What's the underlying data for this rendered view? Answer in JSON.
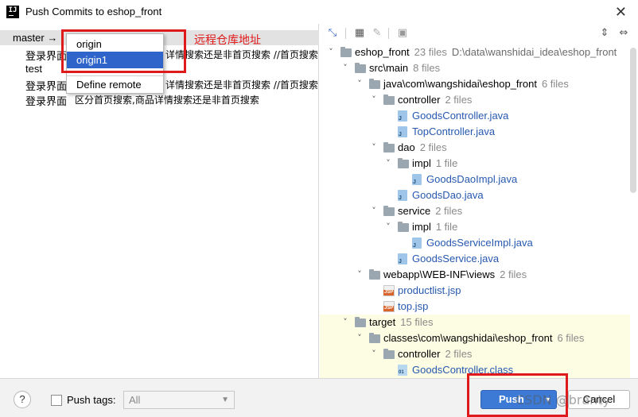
{
  "window": {
    "title": "Push Commits to eshop_front",
    "app_icon_text": "IJ"
  },
  "left": {
    "branch_label": "master →",
    "commits": [
      {
        "text": "登录界面",
        "desc": "详情搜索还是非首页搜索  //首页搜索"
      },
      {
        "text": "test",
        "desc": ""
      },
      {
        "text": "登录界面",
        "desc": "详情搜索还是非首页搜索  //首页搜索"
      },
      {
        "text": "登录界面",
        "desc": "区分首页搜索,商品详情搜索还是非首页搜索"
      }
    ],
    "remote_popup": {
      "items": [
        "origin",
        "origin1",
        "Define remote"
      ]
    },
    "annotation": "远程仓库地址"
  },
  "tree": [
    {
      "name": "eshop_front",
      "count": "23 files",
      "path": "D:\\data\\wanshidai_idea\\eshop_front"
    },
    {
      "name": "src\\main",
      "count": "8 files"
    },
    {
      "name": "java\\com\\wangshidai\\eshop_front",
      "count": "6 files"
    },
    {
      "name": "controller",
      "count": "2 files"
    },
    {
      "name": "GoodsController.java"
    },
    {
      "name": "TopController.java"
    },
    {
      "name": "dao",
      "count": "2 files"
    },
    {
      "name": "impl",
      "count": "1 file"
    },
    {
      "name": "GoodsDaoImpl.java"
    },
    {
      "name": "GoodsDao.java"
    },
    {
      "name": "service",
      "count": "2 files"
    },
    {
      "name": "impl",
      "count": "1 file"
    },
    {
      "name": "GoodsServiceImpl.java"
    },
    {
      "name": "GoodsService.java"
    },
    {
      "name": "webapp\\WEB-INF\\views",
      "count": "2 files"
    },
    {
      "name": "productlist.jsp"
    },
    {
      "name": "top.jsp"
    },
    {
      "name": "target",
      "count": "15 files"
    },
    {
      "name": "classes\\com\\wangshidai\\eshop_front",
      "count": "6 files"
    },
    {
      "name": "controller",
      "count": "2 files"
    },
    {
      "name": "GoodsController.class"
    }
  ],
  "footer": {
    "help": "?",
    "push_tags_label": "Push tags:",
    "push_tags_value": "All",
    "push_label": "Push",
    "cancel_label": "Cancel",
    "watermark": "CSDN @branty"
  },
  "colors": {
    "accent": "#3d7ad6",
    "selection": "#2f65ca",
    "annotation_red": "#e0191a",
    "link": "#2658b0"
  }
}
